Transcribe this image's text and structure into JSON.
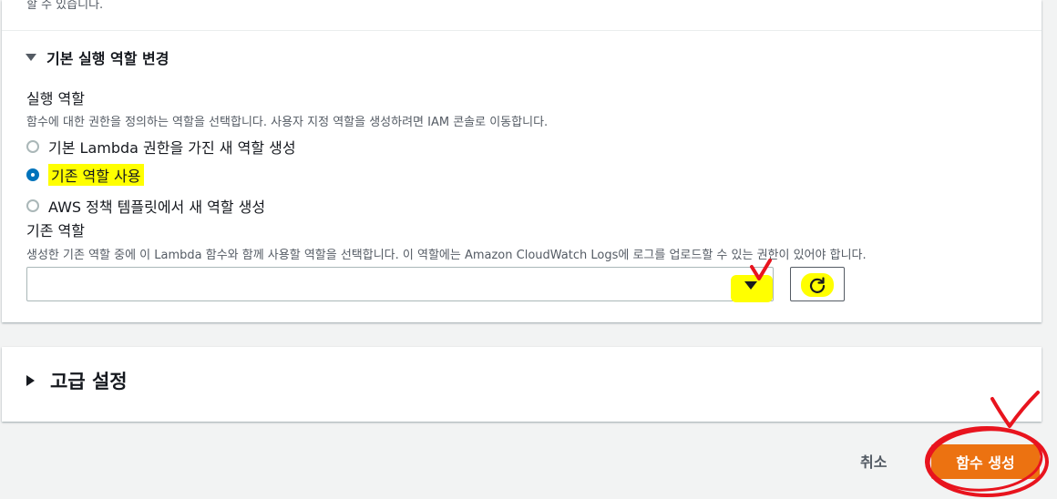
{
  "top_truncated_text": "할 수 있습니다.",
  "section": {
    "title": "기본 실행 역할 변경",
    "execution_role": {
      "label": "실행 역할",
      "description": "함수에 대한 권한을 정의하는 역할을 선택합니다. 사용자 지정 역할을 생성하려면 IAM 콘솔로 이동합니다.",
      "options": [
        {
          "label": "기본 Lambda 권한을 가진 새 역할 생성",
          "selected": false
        },
        {
          "label": "기존 역할 사용",
          "selected": true
        },
        {
          "label": "AWS 정책 템플릿에서 새 역할 생성",
          "selected": false
        }
      ]
    },
    "existing_role": {
      "label": "기존 역할",
      "description": "생성한 기존 역할 중에 이 Lambda 함수와 함께 사용할 역할을 선택합니다. 이 역할에는 Amazon CloudWatch Logs에 로그를 업로드할 수 있는 권한이 있어야 합니다.",
      "selected_value": ""
    }
  },
  "advanced": {
    "title": "고급 설정"
  },
  "footer": {
    "cancel": "취소",
    "create": "함수 생성"
  },
  "icons": {
    "select_caret": "caret-down-icon",
    "refresh": "refresh-icon"
  },
  "colors": {
    "primary_button": "#ec7211",
    "radio_selected": "#0073bb",
    "highlight": "#ffff00",
    "annotation": "#e8141e"
  }
}
